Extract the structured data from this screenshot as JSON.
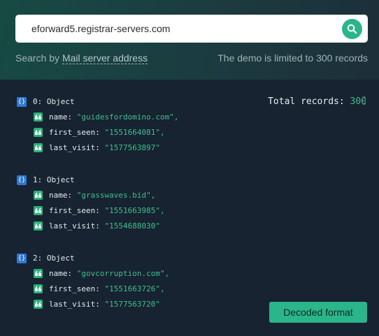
{
  "search": {
    "value": "eforward5.registrar-servers.com",
    "hint_prefix": "Search by",
    "hint_field": "Mail server address",
    "limit_note": "The demo is limited to 300 records"
  },
  "results": {
    "total_label": "Total records:",
    "total_value": "300",
    "records": [
      {
        "header": "0: Object",
        "fields": [
          {
            "key": "name:",
            "value": "\"guidesfordomino.com\","
          },
          {
            "key": "first_seen:",
            "value": "\"1551664081\","
          },
          {
            "key": "last_visit:",
            "value": "\"1577563897\""
          }
        ]
      },
      {
        "header": "1: Object",
        "fields": [
          {
            "key": "name:",
            "value": "\"grasswaves.bid\","
          },
          {
            "key": "first_seen:",
            "value": "\"1551663985\","
          },
          {
            "key": "last_visit:",
            "value": "\"1554688030\""
          }
        ]
      },
      {
        "header": "2: Object",
        "fields": [
          {
            "key": "name:",
            "value": "\"govcorruption.com\","
          },
          {
            "key": "first_seen:",
            "value": "\"1551663726\","
          },
          {
            "key": "last_visit:",
            "value": "\"1577563720\""
          }
        ]
      }
    ],
    "decoded_button": "Decoded format"
  },
  "icons": {
    "object": "braces-icon",
    "string": "quote-icon",
    "search": "search-icon"
  },
  "colors": {
    "accent": "#2bb58a",
    "value_text": "#3fbf8c",
    "object_icon": "#2f79d6",
    "background": "#172330"
  }
}
